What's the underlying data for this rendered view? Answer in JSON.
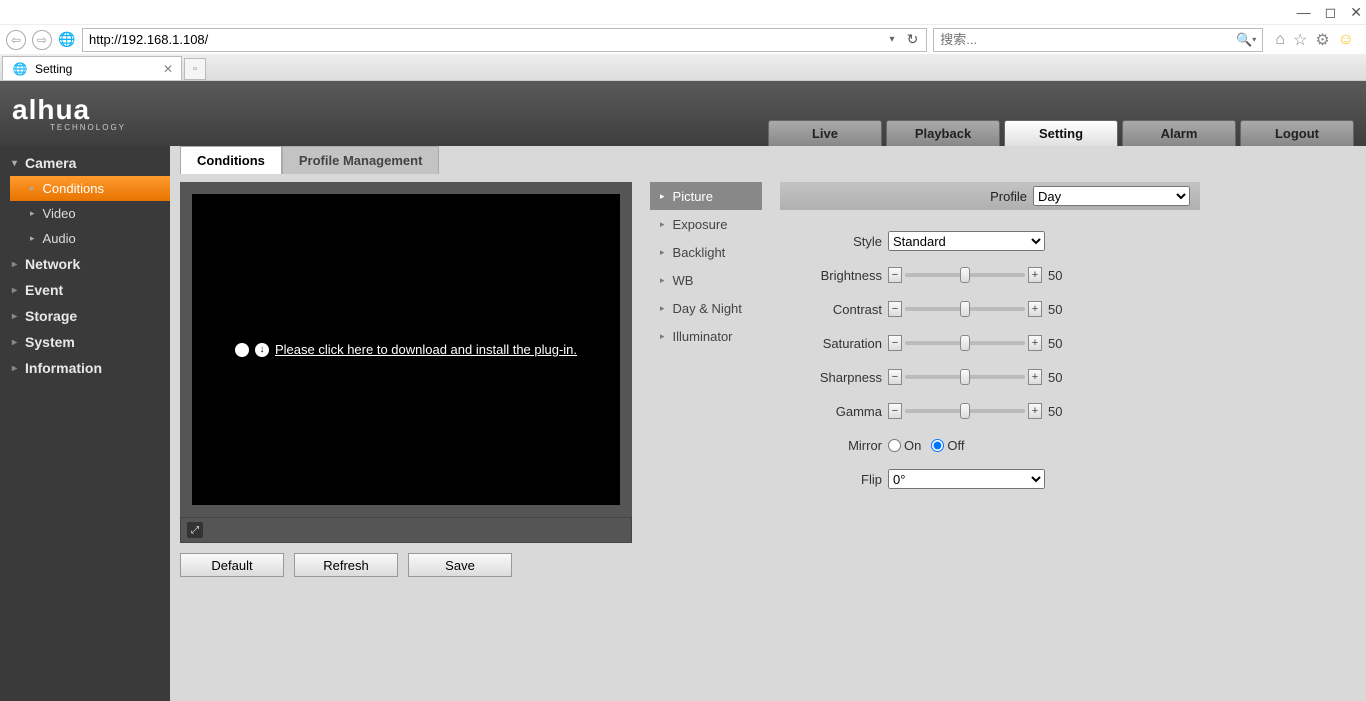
{
  "browser": {
    "url": "http://192.168.1.108/",
    "search_placeholder": "搜索...",
    "tab_title": "Setting"
  },
  "logo": {
    "main": "alhua",
    "sub": "TECHNOLOGY"
  },
  "topnav": [
    "Live",
    "Playback",
    "Setting",
    "Alarm",
    "Logout"
  ],
  "topnav_active": 2,
  "sidebar": {
    "groups": [
      {
        "label": "Camera",
        "expanded": true,
        "subs": [
          "Conditions",
          "Video",
          "Audio"
        ],
        "active_sub": 0
      },
      {
        "label": "Network"
      },
      {
        "label": "Event"
      },
      {
        "label": "Storage"
      },
      {
        "label": "System"
      },
      {
        "label": "Information"
      }
    ]
  },
  "tabs": [
    "Conditions",
    "Profile Management"
  ],
  "tabs_active": 0,
  "plugin_msg": "Please click here to download and install the plug-in.",
  "action_buttons": [
    "Default",
    "Refresh",
    "Save"
  ],
  "midmenu": [
    "Picture",
    "Exposure",
    "Backlight",
    "WB",
    "Day & Night",
    "Illuminator"
  ],
  "midmenu_active": 0,
  "profile": {
    "label": "Profile",
    "value": "Day"
  },
  "form": {
    "style": {
      "label": "Style",
      "value": "Standard"
    },
    "sliders": [
      {
        "label": "Brightness",
        "value": 50
      },
      {
        "label": "Contrast",
        "value": 50
      },
      {
        "label": "Saturation",
        "value": 50
      },
      {
        "label": "Sharpness",
        "value": 50
      },
      {
        "label": "Gamma",
        "value": 50
      }
    ],
    "mirror": {
      "label": "Mirror",
      "on": "On",
      "off": "Off",
      "value": "off"
    },
    "flip": {
      "label": "Flip",
      "value": "0°"
    }
  }
}
